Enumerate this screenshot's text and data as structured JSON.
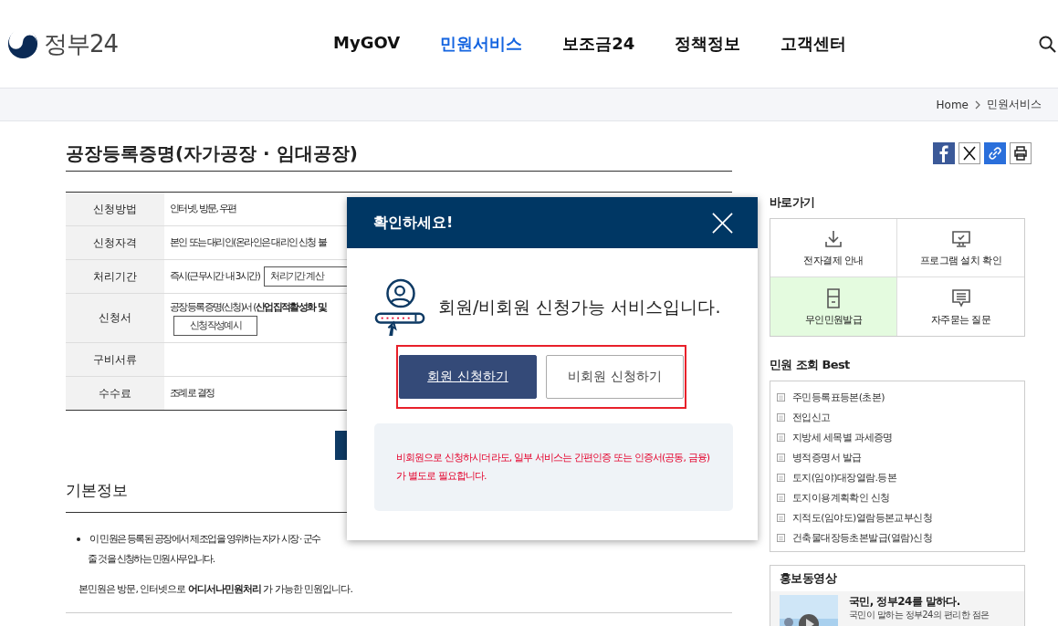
{
  "logo": {
    "text": "정부24"
  },
  "nav": [
    {
      "label": "MyGOV",
      "selected": false
    },
    {
      "label": "민원서비스",
      "selected": true
    },
    {
      "label": "보조금24",
      "selected": false
    },
    {
      "label": "정책정보",
      "selected": false
    },
    {
      "label": "고객센터",
      "selected": false
    }
  ],
  "breadcrumb": [
    "Home",
    "민원서비스"
  ],
  "page_title": "공장등록증명(자가공장 · 임대공장)",
  "info_table": [
    {
      "label": "신청방법",
      "value": "인터넷, 방문, 우편"
    },
    {
      "label": "신청자격",
      "value": "본인 또는 대리인(온라인은 대리인 신청 불"
    },
    {
      "label": "처리기간",
      "value": "즉시(근무시간 내 3시간)",
      "button": "처리기간 계산"
    },
    {
      "label": "신청서",
      "value": "공장등록증명(신청)서 (**산업집적활성화 및**",
      "button": "신청작성예시",
      "button_below": true
    },
    {
      "label": "구비서류"
    },
    {
      "label": "수수료",
      "value": "조례로 결정"
    }
  ],
  "basic_info": {
    "heading": "기본정보",
    "bullet_lines": [
      "이 민원은 등록된 공장에서 제조업을 영위하는 자가 시장 · 군수",
      "줄 것을 신청하는 민원사무입니다."
    ],
    "note": "본민원은 방문, 인터넷으로 **어디서나민원처리** 가 가능한 민원입니다."
  },
  "modal": {
    "title": "확인하세요!",
    "message": "회원/비회원 신청가능 서비스입니다.",
    "buttons": [
      {
        "label": "회원 신청하기",
        "kind": "primary"
      },
      {
        "label": "비회원 신청하기",
        "kind": "secondary"
      }
    ],
    "notice": "비회원으로 신청하시더라도, 일부 서비스는 간편인증 또는 인증서(공동, 금융) 가 별도로 필요합니다."
  },
  "sidebar": {
    "quick_heading": "바로가기",
    "quick_links": [
      {
        "label": "전자결제 안내",
        "kind": "download",
        "highlighted": false
      },
      {
        "label": "프로그램 설치 확인",
        "kind": "monitor",
        "highlighted": false
      },
      {
        "label": "무인민원발급",
        "kind": "kiosk",
        "highlighted": true
      },
      {
        "label": "자주묻는 질문",
        "kind": "chat",
        "highlighted": false
      }
    ],
    "best_heading": "민원 조회 Best",
    "best_items": [
      "주민등록표등본(초본)",
      "전입신고",
      "지방세 세목별 과세증명",
      "병적증명서 발급",
      "토지(임야)대장열람.등본",
      "토지이용계획확인 신청",
      "지적도(임야도)열람등본교부신청",
      "건축물대장등초본발급(열람)신청"
    ],
    "video_heading": "홍보동영상",
    "video_title": "국민, 정부24를 말하다.",
    "video_subtitle": "국민이 말하는 정부24의 편리한 점은"
  }
}
